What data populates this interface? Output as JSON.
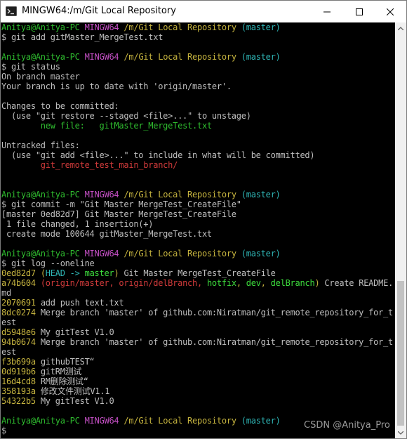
{
  "window": {
    "title": "MINGW64:/m/Git Local Repository",
    "icon": "git-bash-icon",
    "buttons": {
      "minimize": "minimize-icon",
      "maximize": "maximize-icon",
      "close": "close-icon"
    }
  },
  "colors": {
    "background": "#000000",
    "text": "#bfbfbf",
    "green": "#2fbd2f",
    "magenta": "#c34fc3",
    "yellow": "#c6b43f",
    "cyan": "#2fb6b6",
    "red": "#d03a3a"
  },
  "prompt": {
    "user": "Anitya@Anitya-PC",
    "shell": "MINGW64",
    "path": "/m/Git Local Repository",
    "branch": "(master)",
    "symbol": "$"
  },
  "session": {
    "cmd_add": "$ git add gitMaster_MergeTest.txt",
    "cmd_status": "$ git status",
    "status_branch": "On branch master",
    "status_uptodate": "Your branch is up to date with 'origin/master'.",
    "status_changes": "Changes to be committed:",
    "status_restore_hint": "  (use \"git restore --staged <file>...\" to unstage)",
    "status_newfile_label": "new file:",
    "status_newfile_name": "gitMaster_MergeTest.txt",
    "status_untracked": "Untracked files:",
    "status_add_hint": "  (use \"git add <file>...\" to include in what will be committed)",
    "status_untracked_file": "git_remote_test_main_branch/",
    "cmd_commit": "$ git commit -m \"Git Master MergeTest_CreateFile\"",
    "commit_result": "[master 0ed82d7] Git Master MergeTest_CreateFile",
    "commit_stats": " 1 file changed, 1 insertion(+)",
    "commit_mode": " create mode 100644 gitMaster_MergeTest.txt",
    "cmd_log": "$ git log --oneline",
    "final_cursor": "$"
  },
  "log": [
    {
      "hash": "0ed82d7",
      "open": "(",
      "head": "HEAD ->",
      "branch": "master",
      "close": ")",
      "message": "Git Master MergeTest_CreateFile"
    },
    {
      "hash": "a74b604",
      "refs_a": "(origin/master, origin/delBranch, ",
      "hotfix": "hotfix",
      "sep1": ", ",
      "dev": "dev",
      "sep2": ", ",
      "delBranch": "delBranch",
      "close": ")",
      "message": "Create README.",
      "message_cont": "md"
    },
    {
      "hash": "2070691",
      "message": "add push text.txt"
    },
    {
      "hash": "8dc0274",
      "message": "Merge branch 'master' of github.com:Niratman/git_remote_repository_for_t",
      "message_cont": "est"
    },
    {
      "hash": "d5948e6",
      "message": "My gitTest V1.0"
    },
    {
      "hash": "94b0674",
      "message": "Merge branch 'master' of github.com:Niratman/git_remote_repository_for_t",
      "message_cont": "est"
    },
    {
      "hash": "f3b699a",
      "message": "githubTEST“"
    },
    {
      "hash": "0d919b6",
      "message": "gitRM测试"
    },
    {
      "hash": "16d4cd8",
      "message": "RM删除测试“"
    },
    {
      "hash": "358193a",
      "message": "修改文件测试V1.1"
    },
    {
      "hash": "54322b5",
      "message": "My gitTest V1.0"
    }
  ],
  "watermark": "CSDN @Anitya_Pro"
}
